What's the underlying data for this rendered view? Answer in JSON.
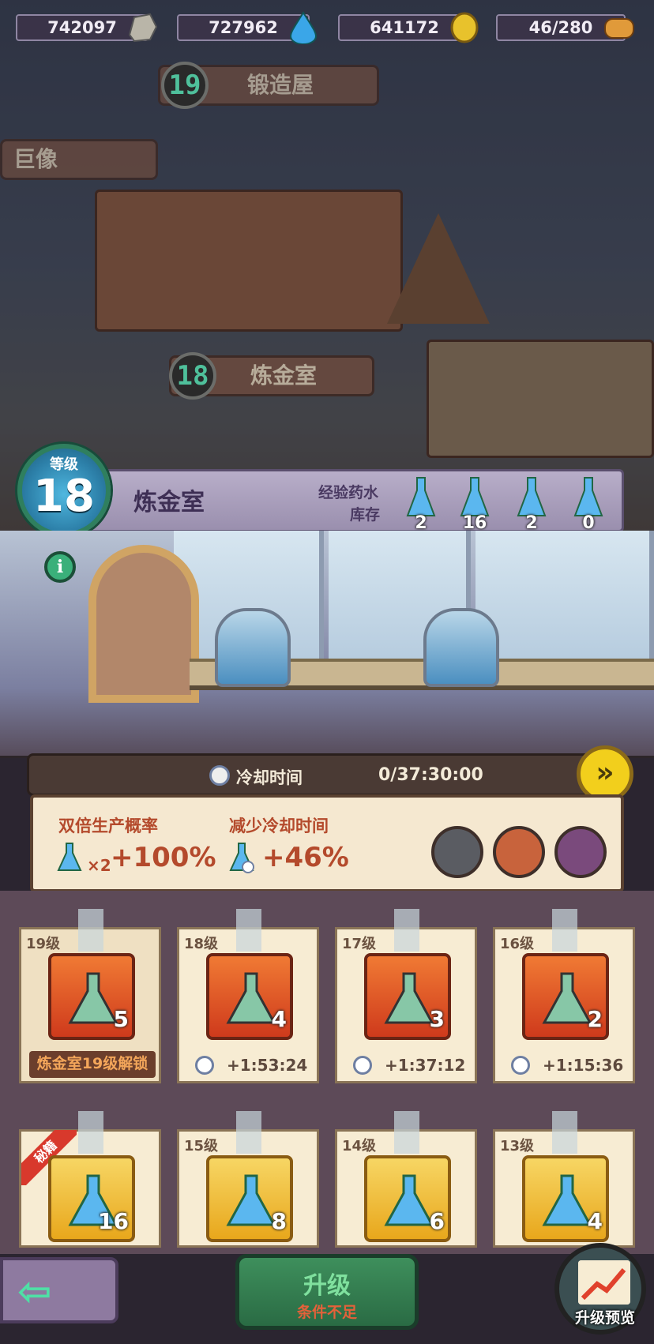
{
  "resources": [
    {
      "value": "742097",
      "icon": "stone-icon"
    },
    {
      "value": "727962",
      "icon": "water-drop-icon"
    },
    {
      "value": "641172",
      "icon": "gold-coin-icon"
    },
    {
      "value": "46/280",
      "icon": "bread-icon"
    }
  ],
  "scene": {
    "forge": {
      "level": "19",
      "name": "锻造屋"
    },
    "colossus": {
      "name": "巨像"
    },
    "alchemy": {
      "level": "18",
      "name": "炼金室"
    }
  },
  "header": {
    "level_label": "等级",
    "level_value": "18",
    "title": "炼金室",
    "stock_label_1": "经验药水",
    "stock_label_2": "库存",
    "stock": [
      "2",
      "16",
      "2",
      "0"
    ]
  },
  "cooldown": {
    "label": "冷却时间",
    "value": "0/37:30:00"
  },
  "bonus": {
    "double_label": "双倍生产概率",
    "double_value": "+100%",
    "double_badge": "×2",
    "reduce_label": "减少冷却时间",
    "reduce_value": "+46%"
  },
  "recipes_row1": [
    {
      "level": "19级",
      "count": "5",
      "locked_text": "炼金室19级解锁"
    },
    {
      "level": "18级",
      "count": "4",
      "time": "+1:53:24"
    },
    {
      "level": "17级",
      "count": "3",
      "time": "+1:37:12"
    },
    {
      "level": "16级",
      "count": "2",
      "time": "+1:15:36"
    }
  ],
  "recipes_row2": [
    {
      "level": "",
      "count": "16",
      "ribbon": "秘籍"
    },
    {
      "level": "15级",
      "count": "8"
    },
    {
      "level": "14级",
      "count": "6"
    },
    {
      "level": "13级",
      "count": "4"
    }
  ],
  "footer": {
    "upgrade": "升级",
    "upgrade_sub": "条件不足",
    "preview": "升级预览"
  },
  "colors": {
    "accent_green": "#3e8f5c",
    "warning_red": "#e4613a",
    "gold": "#f2cf1c"
  }
}
